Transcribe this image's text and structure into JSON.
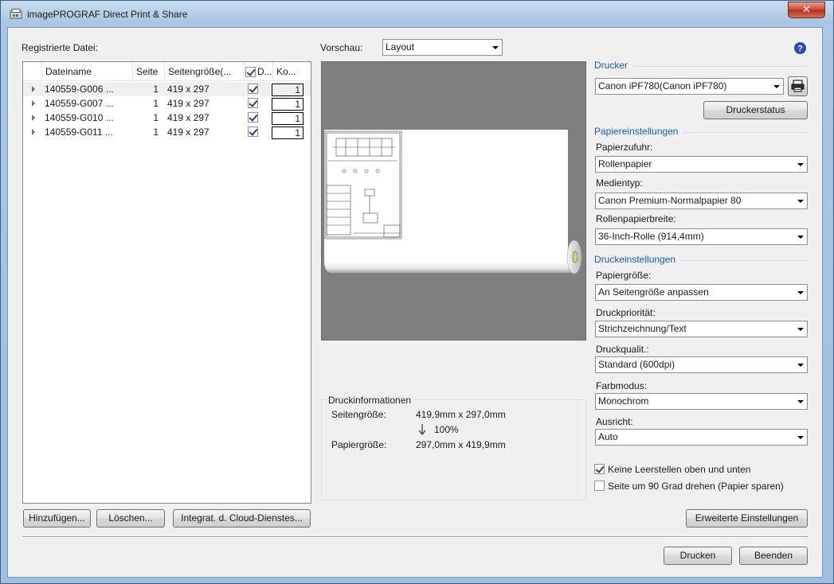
{
  "window": {
    "title": "imagePROGRAF Direct Print & Share",
    "close_label": "✕"
  },
  "left": {
    "section_label": "Registrierte Datei:",
    "columns": [
      "Dateiname",
      "Seite",
      "Seitengröße(...",
      "D...",
      "Ko..."
    ],
    "rows": [
      {
        "name": "140559-G006 ...",
        "page": "1",
        "size": "419 x 297",
        "print": true,
        "copies": "1"
      },
      {
        "name": "140559-G007 ...",
        "page": "1",
        "size": "419 x 297",
        "print": true,
        "copies": "1"
      },
      {
        "name": "140559-G010 ...",
        "page": "1",
        "size": "419 x 297",
        "print": true,
        "copies": "1"
      },
      {
        "name": "140559-G011 ...",
        "page": "1",
        "size": "419 x 297",
        "print": true,
        "copies": "1"
      }
    ],
    "buttons": {
      "add": "Hinzufügen...",
      "delete": "Löschen...",
      "cloud": "Integrat. d. Cloud-Dienstes..."
    }
  },
  "preview": {
    "label": "Vorschau:",
    "mode": "Layout"
  },
  "info": {
    "title": "Druckinformationen",
    "page_size_label": "Seitengröße:",
    "page_size_value": "419,9mm x 297,0mm",
    "scale": "100%",
    "paper_size_label": "Papiergröße:",
    "paper_size_value": "297,0mm x 419,9mm"
  },
  "right": {
    "help_icon": "?",
    "printer_group": "Drucker",
    "printer_value": "Canon iPF780(Canon iPF780)",
    "printer_status_button": "Druckerstatus",
    "paper_group": "Papiereinstellungen",
    "paper_source_label": "Papierzufuhr:",
    "paper_source_value": "Rollenpapier",
    "media_type_label": "Medientyp:",
    "media_type_value": "Canon Premium-Normalpapier 80",
    "roll_width_label": "Rollenpapierbreite:",
    "roll_width_value": "36-Inch-Rolle (914,4mm)",
    "print_group": "Druckeinstellungen",
    "paper_size_label": "Papiergröße:",
    "paper_size_value": "An Seitengröße anpassen",
    "priority_label": "Druckpriorität:",
    "priority_value": "Strichzeichnung/Text",
    "quality_label": "Druckqualit.:",
    "quality_value": "Standard (600dpi)",
    "color_label": "Farbmodus:",
    "color_value": "Monochrom",
    "orientation_label": "Ausricht:",
    "orientation_value": "Auto",
    "no_margins_label": "Keine Leerstellen oben und unten",
    "no_margins_checked": true,
    "rotate_label": "Seite um 90 Grad drehen (Papier sparen)",
    "rotate_checked": false,
    "advanced_button": "Erweiterte Einstellungen"
  },
  "footer": {
    "print_button": "Drucken",
    "exit_button": "Beenden"
  },
  "colors": {
    "group_title": "#1c5dac",
    "preview_bg": "#7f7f7f",
    "help_icon": "#2a4fb0"
  }
}
